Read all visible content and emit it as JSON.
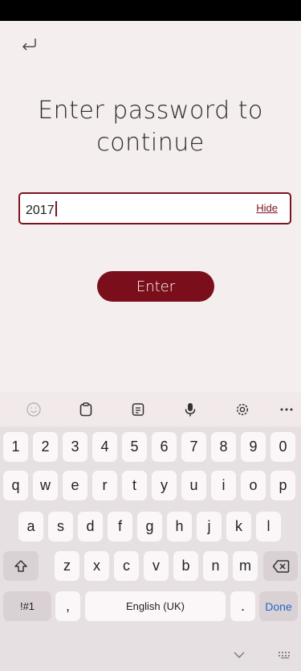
{
  "screen": {
    "title_line1": "Enter password to",
    "title_line2": "continue"
  },
  "password": {
    "value": "2017",
    "hide_label": "Hide"
  },
  "enter_button": {
    "label": "Enter"
  },
  "colors": {
    "accent": "#7a0f1b",
    "background": "#f4eeee",
    "done": "#2a66c8"
  },
  "keyboard": {
    "toolbar_icons": [
      "emoji-icon",
      "clipboard-icon",
      "document-icon",
      "microphone-icon",
      "settings-icon",
      "more-icon"
    ],
    "row_numbers": [
      "1",
      "2",
      "3",
      "4",
      "5",
      "6",
      "7",
      "8",
      "9",
      "0"
    ],
    "row1": [
      "q",
      "w",
      "e",
      "r",
      "t",
      "y",
      "u",
      "i",
      "o",
      "p"
    ],
    "row2": [
      "a",
      "s",
      "d",
      "f",
      "g",
      "h",
      "j",
      "k",
      "l"
    ],
    "row3": [
      "z",
      "x",
      "c",
      "v",
      "b",
      "n",
      "m"
    ],
    "symbols_label": "!#1",
    "comma_label": ",",
    "space_label": "English (UK)",
    "period_label": ".",
    "done_label": "Done"
  }
}
